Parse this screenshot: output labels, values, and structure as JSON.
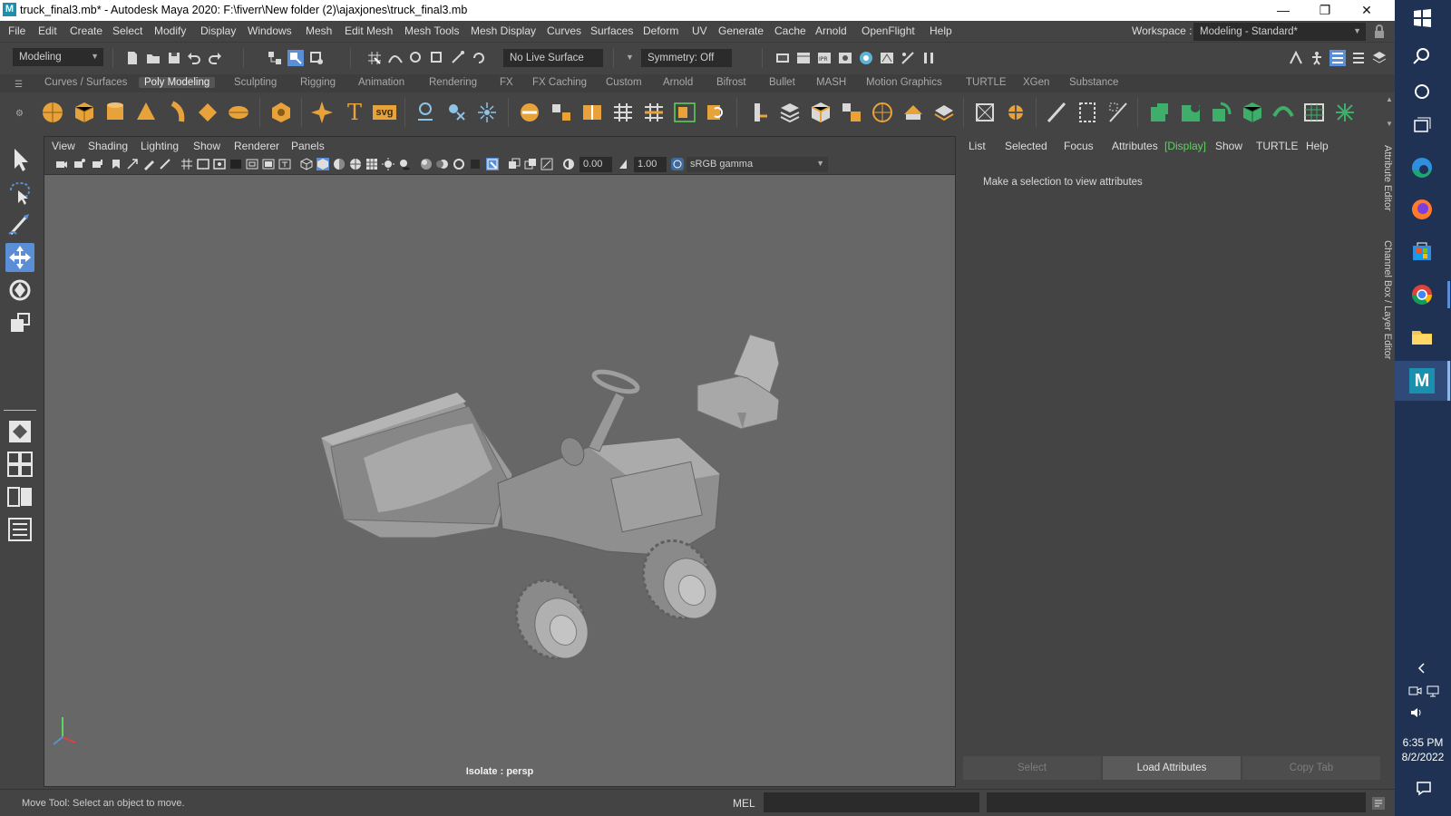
{
  "window": {
    "title": "truck_final3.mb* - Autodesk Maya 2020: F:\\fiverr\\New folder (2)\\ajaxjones\\truck_final3.mb"
  },
  "menubar": [
    "File",
    "Edit",
    "Create",
    "Select",
    "Modify",
    "Display",
    "Windows",
    "Mesh",
    "Edit Mesh",
    "Mesh Tools",
    "Mesh Display",
    "Curves",
    "Surfaces",
    "Deform",
    "UV",
    "Generate",
    "Cache",
    "Arnold",
    "OpenFlight",
    "Help"
  ],
  "workspace": {
    "label": "Workspace :",
    "value": "Modeling - Standard*"
  },
  "statusline": {
    "menuset": "Modeling",
    "live_surface": "No Live Surface",
    "symmetry": "Symmetry: Off"
  },
  "shelf_tabs": [
    "Curves / Surfaces",
    "Poly Modeling",
    "Sculpting",
    "Rigging",
    "Animation",
    "Rendering",
    "FX",
    "FX Caching",
    "Custom",
    "Arnold",
    "Bifrost",
    "Bullet",
    "MASH",
    "Motion Graphics",
    "TURTLE",
    "XGen",
    "Substance"
  ],
  "shelf_active": "Poly Modeling",
  "shelf_text_icons": {
    "type": "T",
    "svg": "svg"
  },
  "viewport": {
    "menu": [
      "View",
      "Shading",
      "Lighting",
      "Show",
      "Renderer",
      "Panels"
    ],
    "exposure": "0.00",
    "gamma": "1.00",
    "color_space": "sRGB gamma",
    "label": "Isolate : persp"
  },
  "attribute_editor": {
    "menu": [
      "List",
      "Selected",
      "Focus",
      "Attributes",
      "[Display]",
      "Show",
      "TURTLE",
      "Help"
    ],
    "highlighted": "[Display]",
    "message": "Make a selection to view attributes",
    "buttons": {
      "select": "Select",
      "load": "Load Attributes",
      "copy": "Copy Tab"
    },
    "side_tabs": [
      "Attribute Editor",
      "Channel Box / Layer Editor"
    ]
  },
  "helpline": {
    "text": "Move Tool: Select an object to move.",
    "mel": "MEL"
  },
  "taskbar": {
    "time": "6:35 PM",
    "date": "8/2/2022"
  },
  "colors": {
    "accent_blue": "#5a8fd6",
    "highlight_green": "#5fd35f",
    "taskbar": "#1f3254",
    "shelf_orange": "#e8a23a"
  }
}
